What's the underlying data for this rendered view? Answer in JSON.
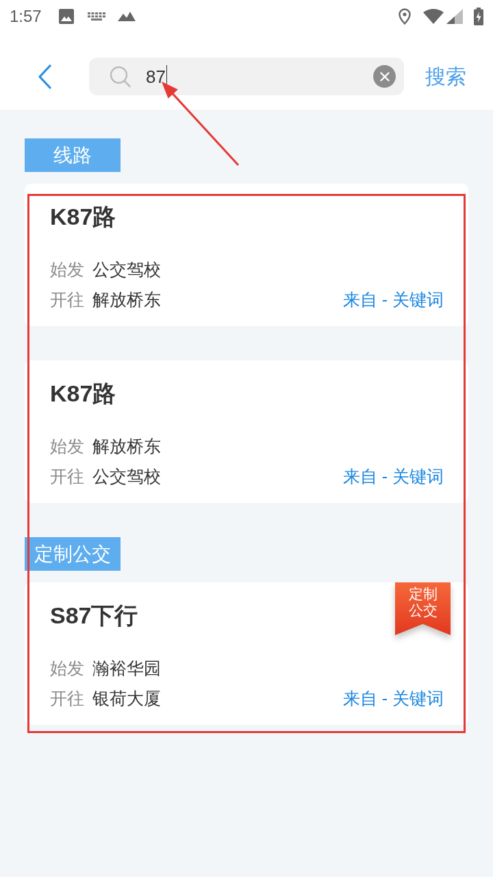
{
  "status_bar": {
    "time": "1:57"
  },
  "search_bar": {
    "query": "87",
    "focused": true,
    "search_button": "搜索"
  },
  "sections": [
    {
      "title": "线路",
      "routes": [
        {
          "name": "K87路",
          "stops": [
            {
              "label": "始发",
              "value": "公交驾校"
            },
            {
              "label": "开往",
              "value": "解放桥东"
            }
          ],
          "source": "来自 - 关键词"
        },
        {
          "name": "K87路",
          "stops": [
            {
              "label": "始发",
              "value": "解放桥东"
            },
            {
              "label": "开往",
              "value": "公交驾校"
            }
          ],
          "source": "来自 - 关键词"
        }
      ]
    },
    {
      "title": "定制公交",
      "routes": [
        {
          "name": "S87下行",
          "badge": "定制公交",
          "stops": [
            {
              "label": "始发",
              "value": "瀚裕华园"
            },
            {
              "label": "开往",
              "value": "银荷大厦"
            }
          ],
          "source": "来自 - 关键词"
        }
      ]
    }
  ],
  "annotation": {
    "highlight_box": true,
    "pointer_arrow": true
  }
}
